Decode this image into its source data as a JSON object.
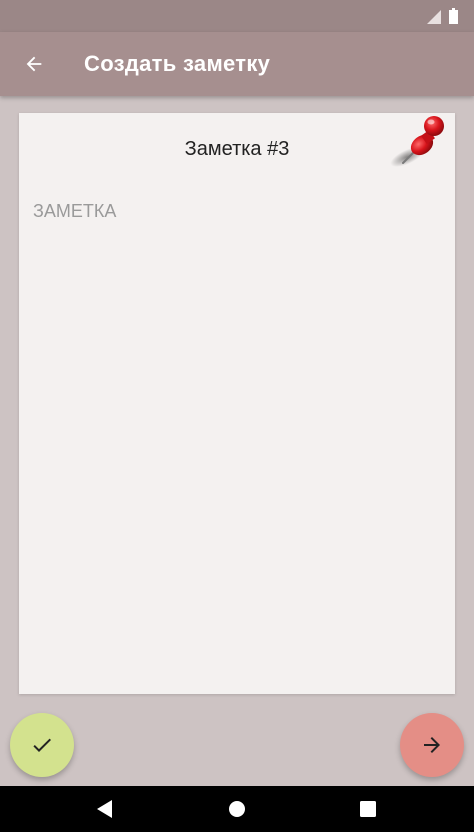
{
  "app_bar": {
    "title": "Создать заметку",
    "back_icon": "arrow-back-icon"
  },
  "status_bar": {
    "icons": [
      "signal-icon",
      "battery-icon"
    ]
  },
  "note": {
    "title": "Заметка #3",
    "body_placeholder": "ЗАМЕТКА",
    "body_value": "",
    "pin_icon": "push-pin-icon"
  },
  "actions": {
    "confirm_icon": "check-icon",
    "next_icon": "arrow-forward-icon"
  },
  "nav_bar": {
    "items": [
      "back-triangle-icon",
      "home-circle-icon",
      "recents-square-icon"
    ]
  },
  "colors": {
    "status_bar": "#9b8787",
    "app_bar": "#a68f8f",
    "background": "#cdc3c3",
    "card": "#f4f1f0",
    "confirm_fab": "#d3e28e",
    "next_fab": "#e48e86",
    "pin": "#d0131a"
  }
}
